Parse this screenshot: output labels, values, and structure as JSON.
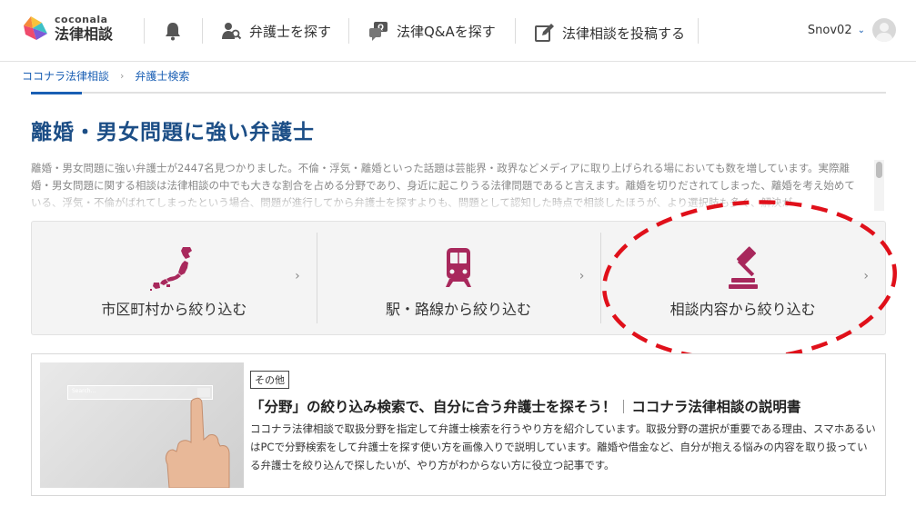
{
  "header": {
    "logo_sub": "coconala",
    "logo_main": "法律相談",
    "nav": [
      {
        "label": "弁護士を探す",
        "icon": "lawyer-search-icon"
      },
      {
        "label": "法律Q&Aを探す",
        "icon": "qa-chat-icon"
      },
      {
        "label": "法律相談を投稿する",
        "icon": "edit-post-icon"
      }
    ],
    "username": "Snov02",
    "user_chevron": "⌄"
  },
  "breadcrumb": {
    "items": [
      "ココナラ法律相談",
      "弁護士検索"
    ],
    "separator": "›"
  },
  "page": {
    "title": "離婚・男女問題に強い弁護士",
    "description": "離婚・男女問題に強い弁護士が2447名見つかりました。不倫・浮気・離婚といった話題は芸能界・政界などメディアに取り上げられる場においても数を増しています。実際離婚・男女問題に関する相談は法律相談の中でも大きな割合を占める分野であり、身近に起こりうる法律問題であると言えます。離婚を切りだされてしまった、離婚を考え始めている、浮気・不倫がばれてしまったという場合、問題が進行してから弁護士を探すよりも、問題として認知した時点で相談したほうが、より選択肢も多く、解決が"
  },
  "filters": [
    {
      "label": "市区町村から絞り込む",
      "icon": "japan-map-icon"
    },
    {
      "label": "駅・路線から絞り込む",
      "icon": "train-icon"
    },
    {
      "label": "相談内容から絞り込む",
      "icon": "gavel-icon"
    }
  ],
  "filter_arrow": "›",
  "article": {
    "tag": "その他",
    "title_main": "「分野」の絞り込み検索で、自分に合う弁護士を探そう！",
    "title_sub": "ココナラ法律相談の説明書",
    "body": "ココナラ法律相談で取扱分野を指定して弁護士検索を行うやり方を紹介しています。取扱分野の選択が重要である理由、スマホあるいはPCで分野検索をして弁護士を探す使い方を画像入りで説明しています。離婚や借金など、自分が抱える悩みの内容を取り扱っている弁護士を絞り込んで探したいが、やり方がわからない方に役立つ記事です。",
    "thumb_search_text": "Search..."
  },
  "colors": {
    "brand_blue": "#1c4e86",
    "link_blue": "#1a5fb4",
    "icon_magenta": "#a8285c",
    "annotation_red": "#e0101a"
  }
}
